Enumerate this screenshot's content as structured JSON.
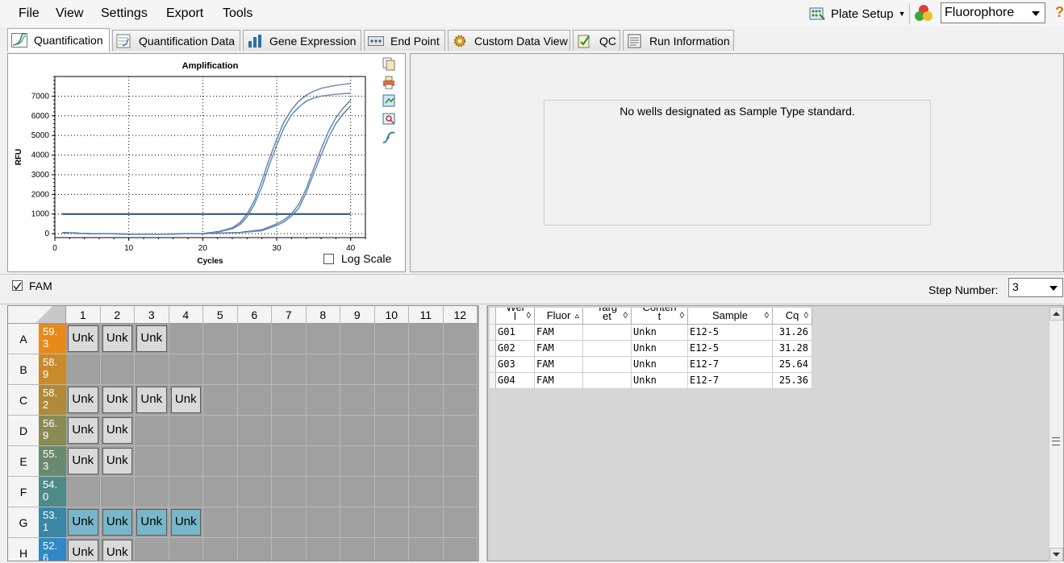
{
  "menu": {
    "items": [
      "File",
      "View",
      "Settings",
      "Export",
      "Tools"
    ],
    "plate_setup": "Plate Setup",
    "fluorophore": "Fluorophore"
  },
  "tabs": [
    {
      "label": "Quantification",
      "icon": "amplification-curve-icon",
      "active": true
    },
    {
      "label": "Quantification Data",
      "icon": "data-sheet-icon"
    },
    {
      "label": "Gene Expression",
      "icon": "bar-chart-icon"
    },
    {
      "label": "End Point",
      "icon": "endpoint-icon"
    },
    {
      "label": "Custom Data View",
      "icon": "gear-icon"
    },
    {
      "label": "QC",
      "icon": "checklist-icon"
    },
    {
      "label": "Run Information",
      "icon": "info-sheet-icon"
    }
  ],
  "chart_data": {
    "type": "line",
    "title": "Amplification",
    "xlabel": "Cycles",
    "ylabel": "RFU",
    "xlim": [
      0,
      42
    ],
    "ylim": [
      -200,
      8000
    ],
    "xticks": [
      0,
      10,
      20,
      30,
      40
    ],
    "yticks": [
      0,
      1000,
      2000,
      3000,
      4000,
      5000,
      6000,
      7000
    ],
    "grid": true,
    "threshold": 1000,
    "series": [
      {
        "x": [
          1,
          5,
          10,
          15,
          20,
          22,
          24,
          25,
          26,
          27,
          28,
          29,
          30,
          31,
          32,
          33,
          34,
          35,
          36,
          38,
          40
        ],
        "y": [
          50,
          0,
          -20,
          -20,
          0,
          100,
          300,
          550,
          1000,
          1700,
          2700,
          3800,
          4800,
          5700,
          6300,
          6750,
          7050,
          7250,
          7400,
          7550,
          7650
        ]
      },
      {
        "x": [
          1,
          5,
          10,
          15,
          20,
          22,
          24,
          25,
          26,
          27,
          28,
          29,
          30,
          31,
          32,
          33,
          34,
          35,
          36,
          38,
          40
        ],
        "y": [
          40,
          0,
          -20,
          -20,
          0,
          80,
          250,
          450,
          850,
          1500,
          2400,
          3500,
          4500,
          5400,
          6050,
          6450,
          6750,
          6900,
          7000,
          7100,
          7150
        ]
      },
      {
        "x": [
          1,
          5,
          10,
          15,
          20,
          25,
          28,
          30,
          31,
          32,
          33,
          34,
          35,
          36,
          37,
          38,
          39,
          40
        ],
        "y": [
          60,
          0,
          -20,
          -20,
          0,
          60,
          200,
          500,
          700,
          1000,
          1500,
          2300,
          3300,
          4300,
          5200,
          5900,
          6400,
          6800
        ]
      },
      {
        "x": [
          1,
          5,
          10,
          15,
          20,
          25,
          28,
          30,
          31,
          32,
          33,
          34,
          35,
          36,
          37,
          38,
          39,
          40
        ],
        "y": [
          50,
          0,
          -20,
          -20,
          0,
          50,
          150,
          420,
          600,
          900,
          1300,
          2100,
          3050,
          4000,
          4900,
          5600,
          6100,
          6500
        ]
      }
    ],
    "log_scale_label": "Log Scale"
  },
  "standard_curve": {
    "message": "No wells designated as Sample Type standard."
  },
  "fluor_toggle": {
    "label": "FAM",
    "checked": true
  },
  "step": {
    "label": "Step Number:",
    "value": "3"
  },
  "plate": {
    "columns": [
      "1",
      "2",
      "3",
      "4",
      "5",
      "6",
      "7",
      "8",
      "9",
      "10",
      "11",
      "12"
    ],
    "rows": [
      {
        "label": "A",
        "temp": "59.\n3",
        "color": "#e88a1a",
        "wells": [
          "Unk",
          "Unk",
          "Unk",
          "",
          "",
          "",
          "",
          "",
          "",
          "",
          "",
          ""
        ]
      },
      {
        "label": "B",
        "temp": "58.\n9",
        "color": "#c98a2a",
        "wells": [
          "",
          "",
          "",
          "",
          "",
          "",
          "",
          "",
          "",
          "",
          "",
          ""
        ]
      },
      {
        "label": "C",
        "temp": "58.\n2",
        "color": "#b08a38",
        "wells": [
          "Unk",
          "Unk",
          "Unk",
          "Unk",
          "",
          "",
          "",
          "",
          "",
          "",
          "",
          ""
        ]
      },
      {
        "label": "D",
        "temp": "56.\n9",
        "color": "#8a8a55",
        "wells": [
          "Unk",
          "Unk",
          "",
          "",
          "",
          "",
          "",
          "",
          "",
          "",
          "",
          ""
        ]
      },
      {
        "label": "E",
        "temp": "55.\n3",
        "color": "#6a8a70",
        "wells": [
          "Unk",
          "Unk",
          "",
          "",
          "",
          "",
          "",
          "",
          "",
          "",
          "",
          ""
        ]
      },
      {
        "label": "F",
        "temp": "54.\n0",
        "color": "#4f8a88",
        "wells": [
          "",
          "",
          "",
          "",
          "",
          "",
          "",
          "",
          "",
          "",
          "",
          ""
        ]
      },
      {
        "label": "G",
        "temp": "53.\n1",
        "color": "#3a86a5",
        "wells": [
          "Unk",
          "Unk",
          "Unk",
          "Unk",
          "",
          "",
          "",
          "",
          "",
          "",
          "",
          ""
        ]
      },
      {
        "label": "H",
        "temp": "52.\n6",
        "color": "#2f88c8",
        "wells": [
          "Unk",
          "Unk",
          "",
          "",
          "",
          "",
          "",
          "",
          "",
          "",
          "",
          ""
        ]
      }
    ]
  },
  "table": {
    "headers": [
      "Wel\nl",
      "Fluor",
      "Targ\net",
      "Conten\nt",
      "Sample",
      "Cq"
    ],
    "rows": [
      [
        "G01",
        "FAM",
        "",
        "Unkn",
        "E12-5",
        "31.26"
      ],
      [
        "G02",
        "FAM",
        "",
        "Unkn",
        "E12-5",
        "31.28"
      ],
      [
        "G03",
        "FAM",
        "",
        "Unkn",
        "E12-7",
        "25.64"
      ],
      [
        "G04",
        "FAM",
        "",
        "Unkn",
        "E12-7",
        "25.36"
      ]
    ]
  }
}
